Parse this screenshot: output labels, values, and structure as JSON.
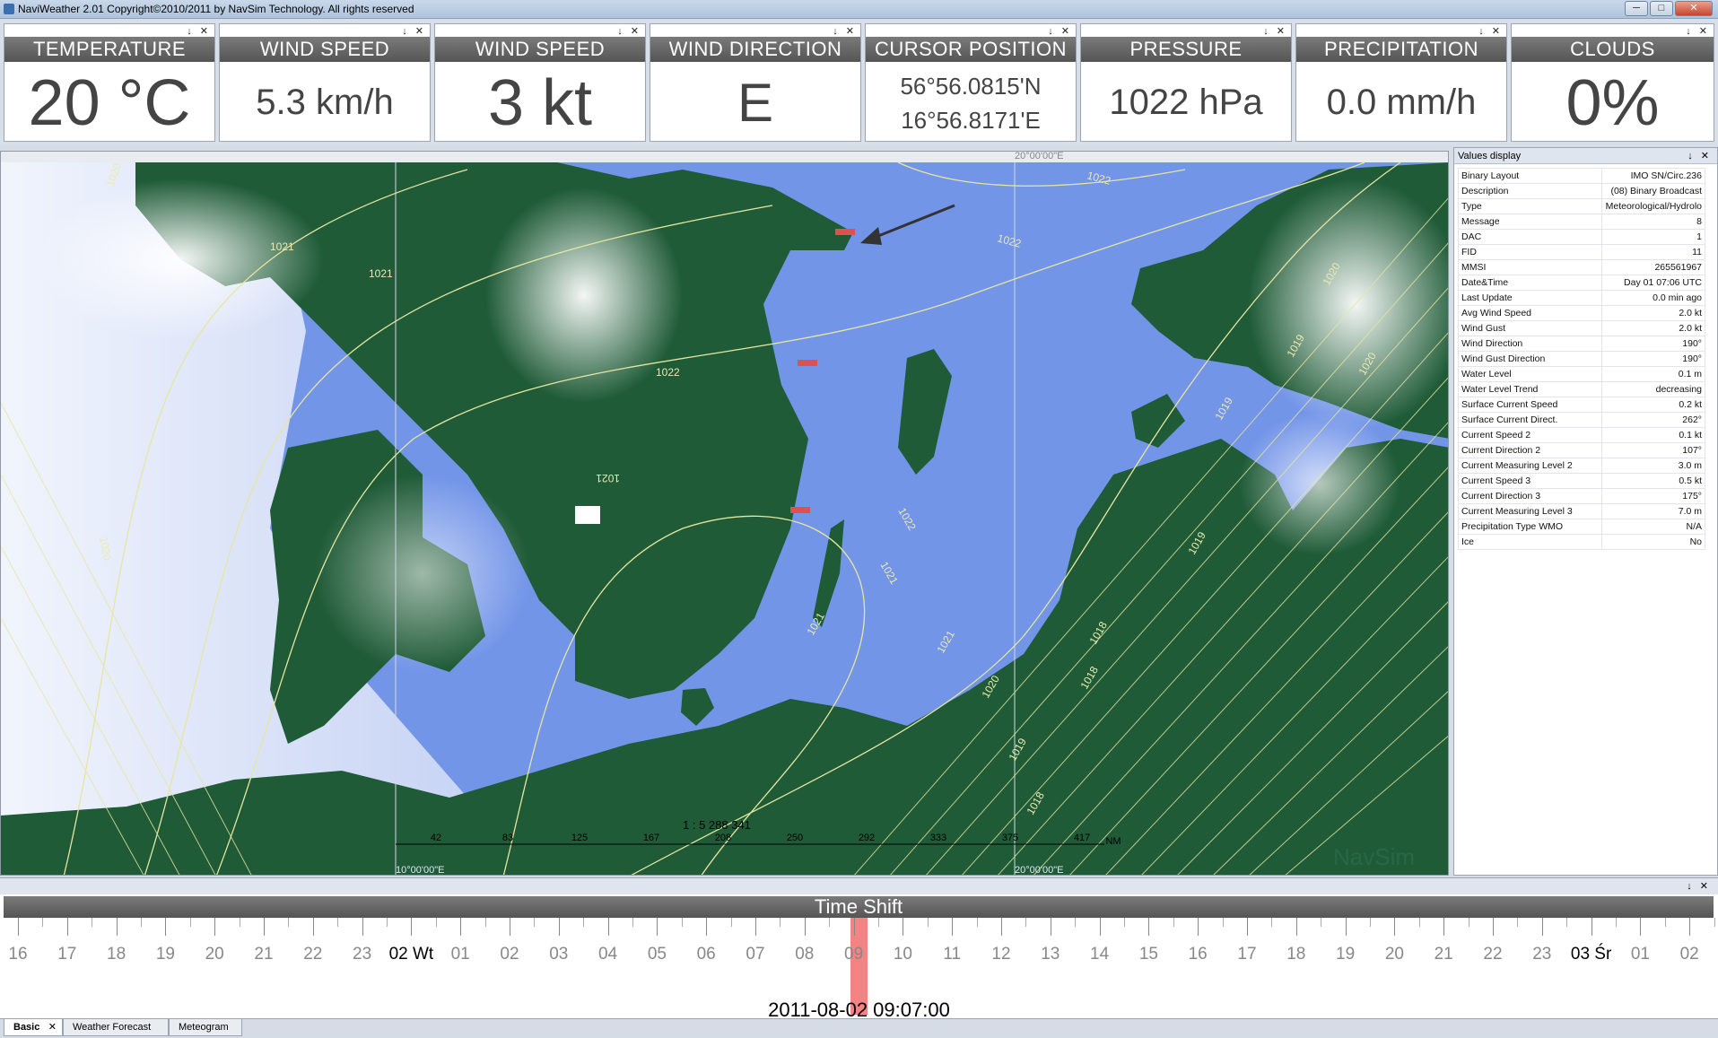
{
  "window": {
    "title": "NaviWeather 2.01 Copyright©2010/2011 by NavSim Technology. All rights reserved",
    "minimize": "─",
    "maximize": "□",
    "close": "✕"
  },
  "panel_controls": "↓ ✕",
  "gauges": [
    {
      "label": "TEMPERATURE",
      "value": "20 °C"
    },
    {
      "label": "WIND SPEED",
      "value": "5.3 km/h"
    },
    {
      "label": "WIND SPEED",
      "value": "3 kt"
    },
    {
      "label": "WIND DIRECTION",
      "value": "E"
    },
    {
      "label": "CURSOR POSITION",
      "value_lines": [
        "56°56.0815'N",
        "16°56.8171'E"
      ]
    },
    {
      "label": "PRESSURE",
      "value": "1022 hPa"
    },
    {
      "label": "PRECIPITATION",
      "value": "0.0 mm/h"
    },
    {
      "label": "CLOUDS",
      "value": "0%"
    }
  ],
  "map": {
    "grid_labels": [
      "20°00'00\"E",
      "10°00'00\"E",
      "20°00'00\"E"
    ],
    "isobars": [
      "1020",
      "1021",
      "1021",
      "1022",
      "1022",
      "1022",
      "1021",
      "1022",
      "1021",
      "1021",
      "1020",
      "1019",
      "1019",
      "1018",
      "1019",
      "1018",
      "1020",
      "1021",
      "1020",
      "1019",
      "1018",
      "1020"
    ],
    "scale_ticks": [
      "42",
      "83",
      "125",
      "167",
      "208",
      "250",
      "292",
      "333",
      "375",
      "417"
    ],
    "scale_unit": "NM",
    "scale_ratio": "1 : 5 288 341",
    "watermark": "NavSim",
    "colors": {
      "sea": "#7395e8",
      "land": "#1f5b37",
      "isobar": "#e6e6a0"
    }
  },
  "values_panel": {
    "title": "Values display",
    "rows": [
      {
        "key": "Binary Layout",
        "value": "IMO SN/Circ.236"
      },
      {
        "key": "Description",
        "value": "(08) Binary Broadcast"
      },
      {
        "key": "Type",
        "value": "Meteorological/Hydrolo"
      },
      {
        "key": "Message",
        "value": "8"
      },
      {
        "key": "DAC",
        "value": "1"
      },
      {
        "key": "FID",
        "value": "11"
      },
      {
        "key": "MMSI",
        "value": "265561967"
      },
      {
        "key": "Date&Time",
        "value": "Day 01 07:06 UTC"
      },
      {
        "key": "Last Update",
        "value": "0.0 min ago"
      },
      {
        "key": "Avg Wind Speed",
        "value": "2.0 kt"
      },
      {
        "key": "Wind Gust",
        "value": "2.0 kt"
      },
      {
        "key": "Wind Direction",
        "value": "190°"
      },
      {
        "key": "Wind Gust Direction",
        "value": "190°"
      },
      {
        "key": "Water Level",
        "value": "0.1 m"
      },
      {
        "key": "Water Level Trend",
        "value": "decreasing"
      },
      {
        "key": "Surface Current Speed",
        "value": "0.2 kt"
      },
      {
        "key": "Surface Current Direct.",
        "value": "262°"
      },
      {
        "key": "Current Speed 2",
        "value": "0.1 kt"
      },
      {
        "key": "Current Direction 2",
        "value": "107°"
      },
      {
        "key": "Current Measuring Level 2",
        "value": "3.0 m"
      },
      {
        "key": "Current Speed 3",
        "value": "0.5 kt"
      },
      {
        "key": "Current Direction 3",
        "value": "175°"
      },
      {
        "key": "Current Measuring Level 3",
        "value": "7.0 m"
      },
      {
        "key": "Precipitation Type WMO",
        "value": "N/A"
      },
      {
        "key": "Ice",
        "value": "No"
      }
    ]
  },
  "timeshift": {
    "title": "Time Shift",
    "hours": [
      "16",
      "17",
      "18",
      "19",
      "20",
      "21",
      "22",
      "23",
      "02 Wt",
      "01",
      "02",
      "03",
      "04",
      "05",
      "06",
      "07",
      "08",
      "09",
      "10",
      "11",
      "12",
      "13",
      "14",
      "15",
      "16",
      "17",
      "18",
      "19",
      "20",
      "21",
      "22",
      "23",
      "03 Śr",
      "01",
      "02"
    ],
    "day_markers": [
      "02 Wt",
      "03 Śr"
    ],
    "current_datetime": "2011-08-02 09:07:00",
    "cursor_color": "#f05a5a"
  },
  "tabs": [
    {
      "label": "Basic",
      "close": "✕",
      "active": true
    },
    {
      "label": "Weather Forecast",
      "active": false
    },
    {
      "label": "Meteogram",
      "active": false
    }
  ]
}
